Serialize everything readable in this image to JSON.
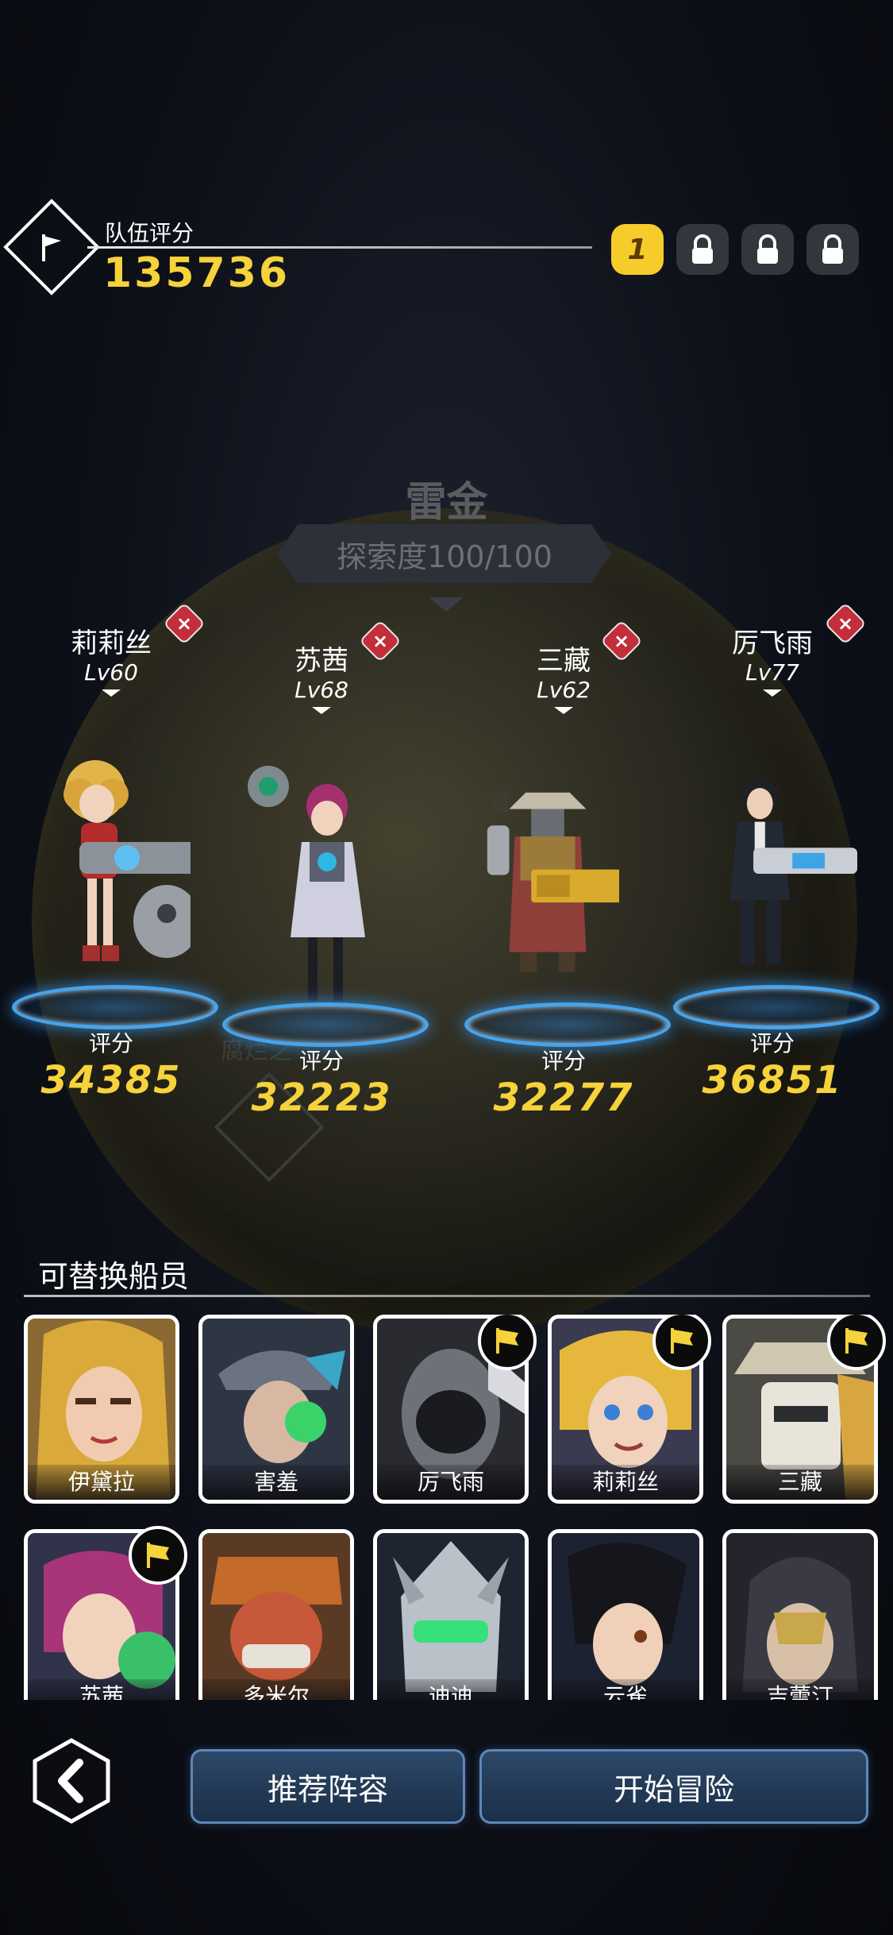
{
  "header": {
    "team_score_label": "队伍评分",
    "team_score": "135736",
    "slots": [
      {
        "label": "1",
        "state": "active"
      },
      {
        "label": "",
        "state": "locked"
      },
      {
        "label": "",
        "state": "locked"
      },
      {
        "label": "",
        "state": "locked"
      }
    ]
  },
  "planet": {
    "title": "雷金",
    "exploration": "探索度100/100",
    "ghost_label_1": "雷",
    "ghost_label_2": "腐烂之"
  },
  "team": [
    {
      "name": "莉莉丝",
      "level": "Lv60",
      "score_label": "评分",
      "score": "34385"
    },
    {
      "name": "苏茜",
      "level": "Lv68",
      "score_label": "评分",
      "score": "32223"
    },
    {
      "name": "三藏",
      "level": "Lv62",
      "score_label": "评分",
      "score": "32277"
    },
    {
      "name": "厉飞雨",
      "level": "Lv77",
      "score_label": "评分",
      "score": "36851"
    }
  ],
  "roster": {
    "title": "可替换船员",
    "crew": [
      {
        "name": "伊黛拉",
        "in_team": false
      },
      {
        "name": "害羞",
        "in_team": false
      },
      {
        "name": "厉飞雨",
        "in_team": true
      },
      {
        "name": "莉莉丝",
        "in_team": true
      },
      {
        "name": "三藏",
        "in_team": true
      },
      {
        "name": "苏茜",
        "in_team": true
      },
      {
        "name": "多米尔",
        "in_team": false
      },
      {
        "name": "迪迪",
        "in_team": false
      },
      {
        "name": "云雀",
        "in_team": false
      },
      {
        "name": "吉蕾汀",
        "in_team": false
      }
    ]
  },
  "footer": {
    "recommend_label": "推荐阵容",
    "start_label": "开始冒险"
  },
  "colors": {
    "gold": "#f6d23b",
    "pad_blue": "#4aa3e8",
    "remove_red": "#c22f3b",
    "button_blue": "#2c4868"
  }
}
